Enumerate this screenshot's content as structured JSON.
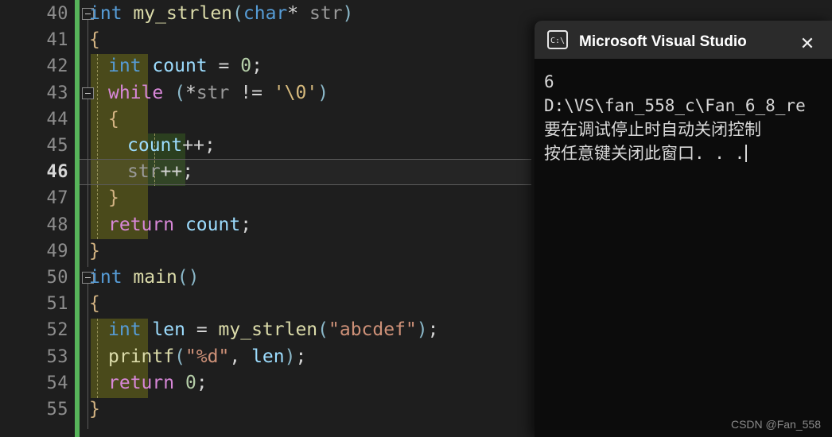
{
  "editor": {
    "lines": [
      {
        "num": "40",
        "indent": 0,
        "fold": true,
        "tokens": [
          {
            "t": "int",
            "c": "t-kw"
          },
          {
            "t": " ",
            "c": "t-pun"
          },
          {
            "t": "my_strlen",
            "c": "t-fn"
          },
          {
            "t": "(",
            "c": "t-paren"
          },
          {
            "t": "char",
            "c": "t-kw"
          },
          {
            "t": "*",
            "c": "t-op"
          },
          {
            "t": " ",
            "c": "t-pun"
          },
          {
            "t": "str",
            "c": "t-id"
          },
          {
            "t": ")",
            "c": "t-paren"
          }
        ]
      },
      {
        "num": "41",
        "indent": 0,
        "fold": false,
        "tokens": [
          {
            "t": "{",
            "c": "t-brc"
          }
        ]
      },
      {
        "num": "42",
        "indent": 1,
        "fold": false,
        "tokens": [
          {
            "t": "int",
            "c": "t-kw"
          },
          {
            "t": " ",
            "c": "t-pun"
          },
          {
            "t": "count",
            "c": "t-var"
          },
          {
            "t": " ",
            "c": "t-pun"
          },
          {
            "t": "=",
            "c": "t-op"
          },
          {
            "t": " ",
            "c": "t-pun"
          },
          {
            "t": "0",
            "c": "t-num"
          },
          {
            "t": ";",
            "c": "t-pun"
          }
        ]
      },
      {
        "num": "43",
        "indent": 1,
        "fold": true,
        "tokens": [
          {
            "t": "while",
            "c": "t-ctl"
          },
          {
            "t": " ",
            "c": "t-pun"
          },
          {
            "t": "(",
            "c": "t-paren"
          },
          {
            "t": "*",
            "c": "t-op"
          },
          {
            "t": "str",
            "c": "t-id"
          },
          {
            "t": " ",
            "c": "t-pun"
          },
          {
            "t": "!=",
            "c": "t-op"
          },
          {
            "t": " ",
            "c": "t-pun"
          },
          {
            "t": "'\\0'",
            "c": "t-chr"
          },
          {
            "t": ")",
            "c": "t-paren"
          }
        ]
      },
      {
        "num": "44",
        "indent": 1,
        "fold": false,
        "tokens": [
          {
            "t": "{",
            "c": "t-brc"
          }
        ]
      },
      {
        "num": "45",
        "indent": 2,
        "fold": false,
        "tokens": [
          {
            "t": "count",
            "c": "t-var"
          },
          {
            "t": "++",
            "c": "t-op"
          },
          {
            "t": ";",
            "c": "t-pun"
          }
        ]
      },
      {
        "num": "46",
        "indent": 2,
        "fold": false,
        "current": true,
        "tokens": [
          {
            "t": "str",
            "c": "t-id"
          },
          {
            "t": "++",
            "c": "t-op"
          },
          {
            "t": ";",
            "c": "t-pun"
          }
        ]
      },
      {
        "num": "47",
        "indent": 1,
        "fold": false,
        "tokens": [
          {
            "t": "}",
            "c": "t-brc"
          }
        ]
      },
      {
        "num": "48",
        "indent": 1,
        "fold": false,
        "tokens": [
          {
            "t": "return",
            "c": "t-ctl"
          },
          {
            "t": " ",
            "c": "t-pun"
          },
          {
            "t": "count",
            "c": "t-var"
          },
          {
            "t": ";",
            "c": "t-pun"
          }
        ]
      },
      {
        "num": "49",
        "indent": 0,
        "fold": false,
        "tokens": [
          {
            "t": "}",
            "c": "t-brc"
          }
        ]
      },
      {
        "num": "50",
        "indent": 0,
        "fold": true,
        "tokens": [
          {
            "t": "int",
            "c": "t-kw"
          },
          {
            "t": " ",
            "c": "t-pun"
          },
          {
            "t": "main",
            "c": "t-fn"
          },
          {
            "t": "()",
            "c": "t-paren"
          }
        ]
      },
      {
        "num": "51",
        "indent": 0,
        "fold": false,
        "tokens": [
          {
            "t": "{",
            "c": "t-brc"
          }
        ]
      },
      {
        "num": "52",
        "indent": 1,
        "fold": false,
        "tokens": [
          {
            "t": "int",
            "c": "t-kw"
          },
          {
            "t": " ",
            "c": "t-pun"
          },
          {
            "t": "len",
            "c": "t-var"
          },
          {
            "t": " ",
            "c": "t-pun"
          },
          {
            "t": "=",
            "c": "t-op"
          },
          {
            "t": " ",
            "c": "t-pun"
          },
          {
            "t": "my_strlen",
            "c": "t-fn"
          },
          {
            "t": "(",
            "c": "t-paren"
          },
          {
            "t": "\"abcdef\"",
            "c": "t-str"
          },
          {
            "t": ")",
            "c": "t-paren"
          },
          {
            "t": ";",
            "c": "t-pun"
          }
        ]
      },
      {
        "num": "53",
        "indent": 1,
        "fold": false,
        "tokens": [
          {
            "t": "printf",
            "c": "t-fn"
          },
          {
            "t": "(",
            "c": "t-paren"
          },
          {
            "t": "\"%d\"",
            "c": "t-str"
          },
          {
            "t": ",",
            "c": "t-pun"
          },
          {
            "t": " ",
            "c": "t-pun"
          },
          {
            "t": "len",
            "c": "t-var"
          },
          {
            "t": ")",
            "c": "t-paren"
          },
          {
            "t": ";",
            "c": "t-pun"
          }
        ]
      },
      {
        "num": "54",
        "indent": 1,
        "fold": false,
        "tokens": [
          {
            "t": "return",
            "c": "t-ctl"
          },
          {
            "t": " ",
            "c": "t-pun"
          },
          {
            "t": "0",
            "c": "t-num"
          },
          {
            "t": ";",
            "c": "t-pun"
          }
        ]
      },
      {
        "num": "55",
        "indent": 0,
        "fold": false,
        "tokens": [
          {
            "t": "}",
            "c": "t-brc"
          }
        ]
      }
    ],
    "highlights": {
      "olive_color": "#4a4a1b",
      "green_color": "#2b3f1f",
      "changebar_color": "#57b45a",
      "background": "#1e1e1e",
      "linenumber_color": "#8d8d8d"
    }
  },
  "console": {
    "title": "Microsoft Visual Studio 调试控",
    "icon": "cmd-prompt-icon",
    "close_label": "✕",
    "lines": [
      "6",
      "D:\\VS\\fan_558_c\\Fan_6_8_re",
      "要在调试停止时自动关闭控制",
      "按任意键关闭此窗口. . ."
    ]
  },
  "watermark": {
    "text": "CSDN @Fan_558"
  }
}
